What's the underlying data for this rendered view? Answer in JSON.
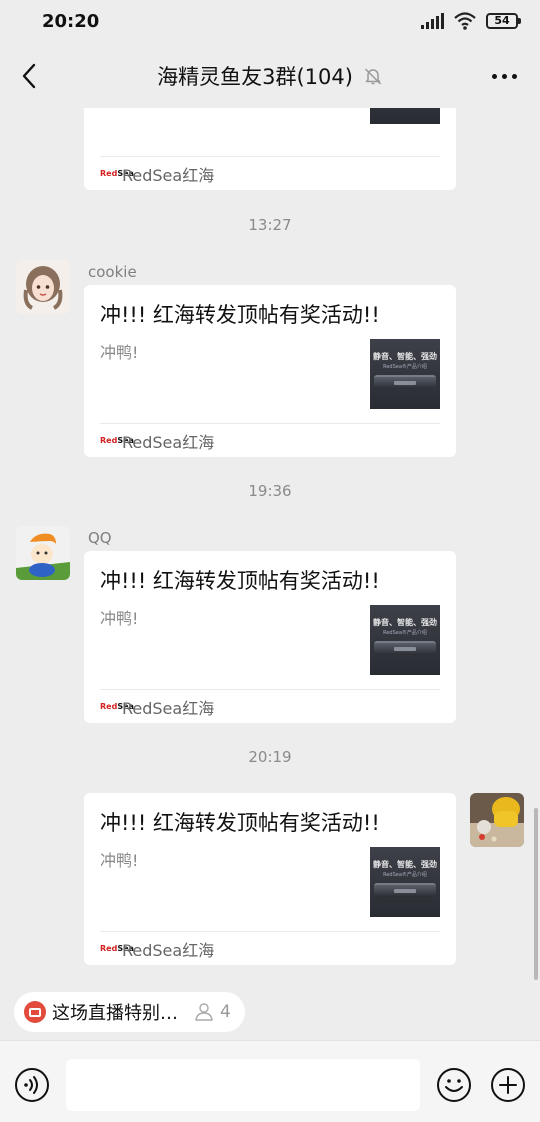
{
  "status_bar": {
    "time": "20:20",
    "battery": "54"
  },
  "header": {
    "title": "海精灵鱼友3群(104)"
  },
  "cards_common": {
    "title": "冲!!! 红海转发顶帖有奖活动!!",
    "desc": "冲鸭!",
    "thumb_text": "静音、智能、强劲",
    "thumb_sub": "RedSea®产品介绍",
    "source_logo_red": "Red",
    "source_logo_black": "Sea",
    "source": "RedSea红海"
  },
  "messages": [
    {
      "time": "",
      "sender": ""
    },
    {
      "time": "13:27",
      "sender": "cookie"
    },
    {
      "time": "19:36",
      "sender": "QQ"
    },
    {
      "time": "20:19",
      "sender": ""
    }
  ],
  "live": {
    "text": "这场直播特别…",
    "viewers": "4"
  },
  "input": {
    "value": ""
  },
  "colors": {
    "background": "#ededed",
    "card": "#ffffff",
    "live_red": "#e24a3c"
  }
}
